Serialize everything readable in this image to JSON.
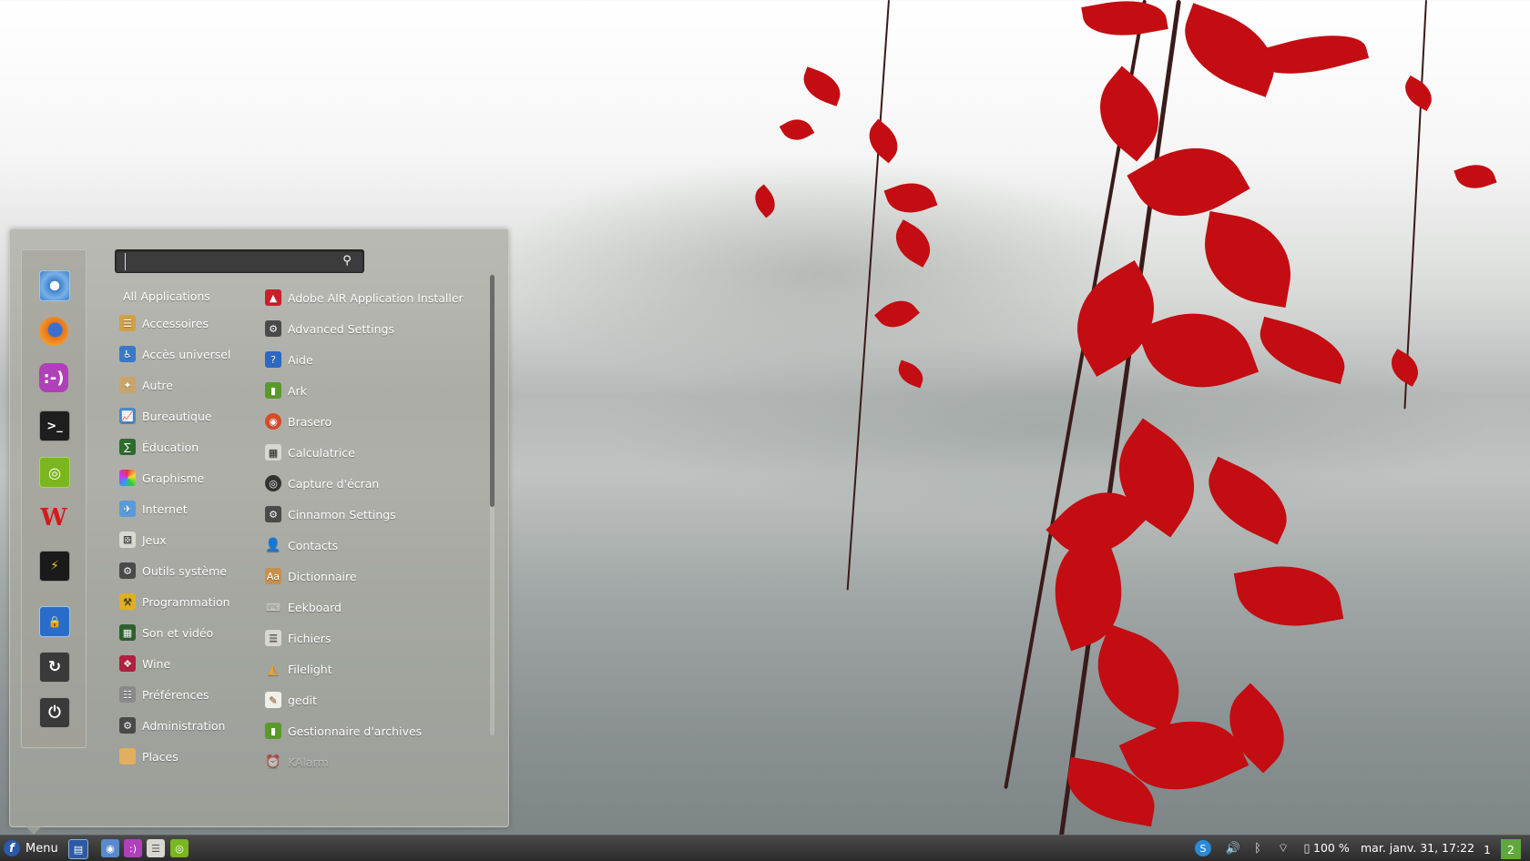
{
  "search": {
    "placeholder": ""
  },
  "favorites": [
    {
      "name": "chromium-icon"
    },
    {
      "name": "firefox-icon"
    },
    {
      "name": "empathy-icon"
    },
    {
      "name": "terminal-icon"
    },
    {
      "name": "nvidia-icon"
    },
    {
      "name": "winamp-icon"
    },
    {
      "name": "system-monitor-icon"
    },
    {
      "name": "lock-screen-icon"
    },
    {
      "name": "logout-icon"
    },
    {
      "name": "shutdown-icon"
    }
  ],
  "categories": [
    {
      "label": "All Applications"
    },
    {
      "label": "Accessoires",
      "icon": "accessories-icon"
    },
    {
      "label": "Accès universel",
      "icon": "accessibility-icon"
    },
    {
      "label": "Autre",
      "icon": "other-icon"
    },
    {
      "label": "Bureautique",
      "icon": "office-icon"
    },
    {
      "label": "Éducation",
      "icon": "education-icon"
    },
    {
      "label": "Graphisme",
      "icon": "graphics-icon"
    },
    {
      "label": "Internet",
      "icon": "internet-icon"
    },
    {
      "label": "Jeux",
      "icon": "games-icon"
    },
    {
      "label": "Outils système",
      "icon": "system-tools-icon"
    },
    {
      "label": "Programmation",
      "icon": "programming-icon"
    },
    {
      "label": "Son et vidéo",
      "icon": "multimedia-icon"
    },
    {
      "label": "Wine",
      "icon": "wine-icon"
    },
    {
      "label": "Préférences",
      "icon": "preferences-icon"
    },
    {
      "label": "Administration",
      "icon": "administration-icon"
    },
    {
      "label": "Places",
      "icon": "places-folder-icon"
    }
  ],
  "apps": [
    {
      "label": "Adobe AIR Application Installer",
      "icon": "adobe-air-icon"
    },
    {
      "label": "Advanced Settings",
      "icon": "settings-icon"
    },
    {
      "label": "Aide",
      "icon": "help-icon"
    },
    {
      "label": "Ark",
      "icon": "ark-icon"
    },
    {
      "label": "Brasero",
      "icon": "brasero-icon"
    },
    {
      "label": "Calculatrice",
      "icon": "calculator-icon"
    },
    {
      "label": "Capture d'écran",
      "icon": "screenshot-icon"
    },
    {
      "label": "Cinnamon Settings",
      "icon": "settings-icon"
    },
    {
      "label": "Contacts",
      "icon": "contacts-icon"
    },
    {
      "label": "Dictionnaire",
      "icon": "dictionary-icon"
    },
    {
      "label": "Eekboard",
      "icon": "keyboard-icon"
    },
    {
      "label": "Fichiers",
      "icon": "files-icon"
    },
    {
      "label": "Filelight",
      "icon": "filelight-icon"
    },
    {
      "label": "gedit",
      "icon": "gedit-icon"
    },
    {
      "label": "Gestionnaire d'archives",
      "icon": "archive-manager-icon"
    },
    {
      "label": "KAlarm",
      "icon": "alarm-icon"
    }
  ],
  "taskbar": {
    "menu_label": "Menu",
    "battery": "100 %",
    "clock": "mar. janv. 31, 17:22",
    "workspaces": [
      "1",
      "2"
    ]
  },
  "colors": {
    "panel": "#2b2b2b",
    "menu_bg": "#a8a8a0",
    "active_workspace": "#5fa83c",
    "accent_red": "#c30d12"
  }
}
